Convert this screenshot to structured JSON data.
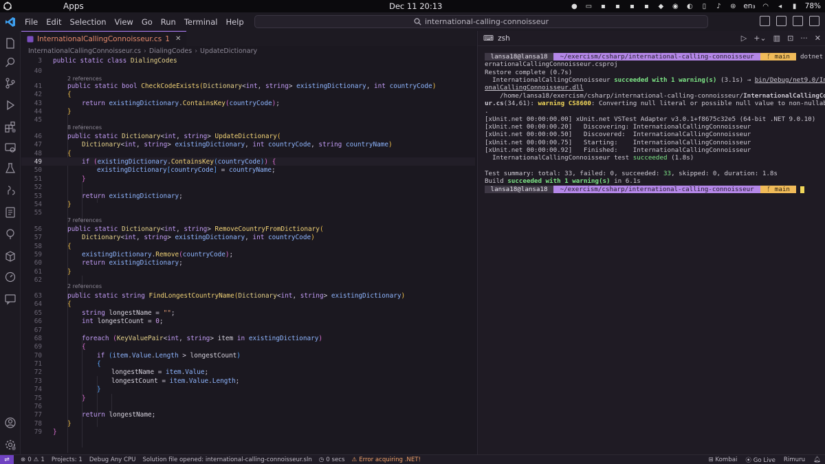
{
  "topbar": {
    "apps_label": "Apps",
    "clock": "Dec 11  20:13",
    "lang": "en₃",
    "battery": "78%"
  },
  "titlebar": {
    "menu": [
      "File",
      "Edit",
      "Selection",
      "View",
      "Go",
      "Run",
      "Terminal",
      "Help"
    ],
    "search": "international-calling-connoisseur"
  },
  "editor": {
    "tab": {
      "name": "InternationalCallingConnoisseur.cs",
      "problems": "1"
    },
    "breadcrumbs": [
      "InternationalCallingConnoisseur.cs",
      "DialingCodes",
      "UpdateDictionary"
    ],
    "lens_refs": [
      "2 references",
      "8 references",
      "7 references",
      "2 references"
    ],
    "line_numbers": [
      "3",
      "40",
      "41",
      "42",
      "43",
      "44",
      "45",
      "46",
      "47",
      "48",
      "49",
      "50",
      "51",
      "52",
      "53",
      "54",
      "55",
      "56",
      "57",
      "58",
      "59",
      "60",
      "61",
      "62",
      "63",
      "64",
      "65",
      "66",
      "67",
      "68",
      "69",
      "70",
      "71",
      "72",
      "73",
      "74",
      "75",
      "76",
      "77",
      "78",
      "79"
    ],
    "current_line": "49"
  },
  "terminal": {
    "tab_label": "zsh",
    "prompt_user": " lansa18@lansa18 ",
    "prompt_path": " ~/exercism/csharp/international-calling-connoisseur ",
    "prompt_branch": " ᚶ main ",
    "command": "dotnet test Int",
    "command_wrap": "ernationalCallingConnoisseur.csproj",
    "restore": "Restore complete (0.7s)",
    "build_project": "  InternationalCallingConnoisseur ",
    "build_succeeded": "succeeded with 1 warning(s)",
    "build_time": " (3.1s) → ",
    "build_out1": "bin/Debug/net9.0/Internati",
    "build_out2": "onalCallingConnoisseur.dll",
    "warn_path1": "    /home/lansa18/exercism/csharp/international-calling-connoisseur/",
    "warn_file1": "InternationalCallingConnoisse",
    "warn_file2": "ur.cs",
    "warn_loc": "(34,61): ",
    "warn_code": "warning CS8600",
    "warn_msg": ": Converting null literal or possible null value to non-nullable type",
    "warn_end": ".",
    "xunit": [
      "[xUnit.net 00:00:00.00] xUnit.net VSTest Adapter v3.0.1+f8675c32e5 (64-bit .NET 9.0.10)",
      "[xUnit.net 00:00:00.20]   Discovering: InternationalCallingConnoisseur",
      "[xUnit.net 00:00:00.50]   Discovered:  InternationalCallingConnoisseur",
      "[xUnit.net 00:00:00.75]   Starting:    InternationalCallingConnoisseur",
      "[xUnit.net 00:00:00.92]   Finished:    InternationalCallingConnoisseur"
    ],
    "test_project": "  InternationalCallingConnoisseur test ",
    "test_succeeded": "succeeded",
    "test_time": " (1.8s)",
    "summary_prefix": "Test summary: total: 33, failed: 0, succeeded: ",
    "summary_succeeded": "33",
    "summary_suffix": ", skipped: 0, duration: 1.8s",
    "build_prefix": "Build ",
    "build_final": "succeeded with 1 warning(s)",
    "build_final_time": " in 6.1s"
  },
  "statusbar": {
    "problems_errors": "0",
    "problems_warnings": "1",
    "projects": "Projects: 1",
    "config": "Debug Any CPU",
    "solution": "Solution file opened: international-calling-connoisseur.sln",
    "timer": "0 secs",
    "error": "Error acquiring .NET!",
    "kombai": "Kombai",
    "golive": "Go Live",
    "user": "Rimuru"
  }
}
